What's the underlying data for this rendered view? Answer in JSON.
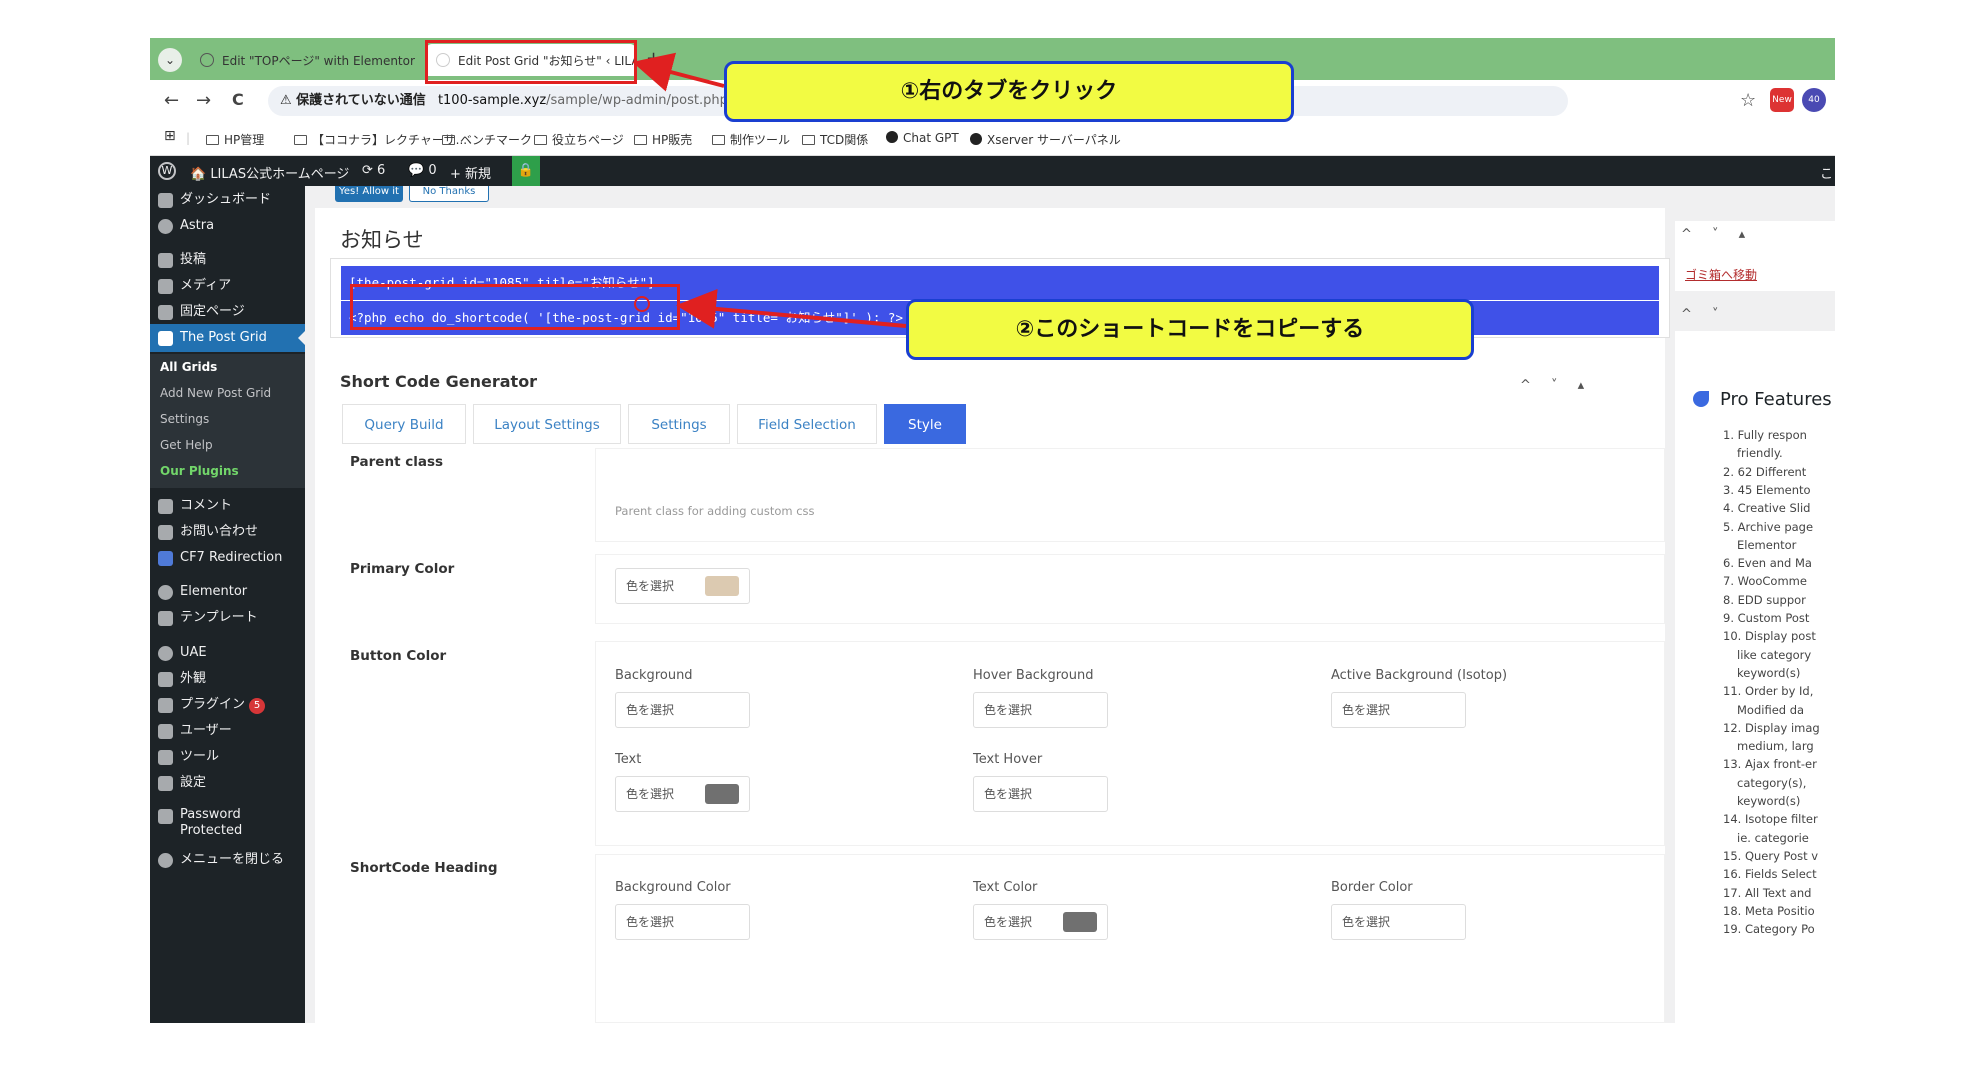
{
  "browser": {
    "tabs": [
      {
        "label": "Edit \"TOPページ\" with Elementor",
        "close": "×"
      },
      {
        "label": "Edit Post Grid \"お知らせ\" ‹ LILAS",
        "close": "×"
      }
    ],
    "new_tab": "+",
    "tab_menu": "⌄",
    "back": "←",
    "forward": "→",
    "reload": "C",
    "security": "⚠ 保護されていない通信",
    "url_host": "t100-sample.xyz",
    "url_path": "/sample/wp-admin/post.php?post=",
    "star": "☆",
    "ext1": "New",
    "ext2": "40",
    "bookmarks_apps": "⊞",
    "bookmarks": [
      "HP管理",
      "【ココナラ】レクチャーサ...",
      "ベンチマーク",
      "役立ちページ",
      "HP販売",
      "制作ツール",
      "TCD関係",
      "Chat GPT",
      "Xserver サーバーパネル"
    ]
  },
  "adminbar": {
    "wp": "W",
    "site": "🏠 LILAS公式ホームページ",
    "updates": "⟳ 6",
    "comments": "💬 0",
    "new": "+ 新規",
    "lock": "🔒",
    "right": "こ"
  },
  "sidebar": {
    "items": [
      {
        "label": "ダッシュボード"
      },
      {
        "label": "Astra"
      },
      {
        "label": "投稿"
      },
      {
        "label": "メディア"
      },
      {
        "label": "固定ページ"
      },
      {
        "label": "The Post Grid"
      },
      {
        "label": "コメント"
      },
      {
        "label": "お問い合わせ"
      },
      {
        "label": "CF7 Redirection"
      },
      {
        "label": "Elementor"
      },
      {
        "label": "テンプレート"
      },
      {
        "label": "UAE"
      },
      {
        "label": "外観"
      },
      {
        "label": "プラグイン"
      },
      {
        "label": "ユーザー"
      },
      {
        "label": "ツール"
      },
      {
        "label": "設定"
      },
      {
        "label": "Password Protected"
      },
      {
        "label": "メニューを閉じる"
      }
    ],
    "plugin_badge": "5",
    "submenu": [
      "All Grids",
      "Add New Post Grid",
      "Settings",
      "Get Help",
      "Our Plugins"
    ]
  },
  "top_buttons": {
    "yes": "Yes! Allow it",
    "no": "No Thanks"
  },
  "post_title": "お知らせ",
  "shortcode": "[the-post-grid id=\"1085\" title=\"お知らせ\"]",
  "php_code": "<?php echo do_shortcode( '[the-post-grid id=\"1085\" title=\"お知らせ\"]' ); ?>",
  "generator": {
    "title": "Short Code Generator",
    "arrows": "^ ˅ ▴",
    "tabs": [
      "Query Build",
      "Layout Settings",
      "Settings",
      "Field Selection",
      "Style"
    ],
    "parent_class": {
      "label": "Parent class",
      "hint": "Parent class for adding custom css"
    },
    "primary_color": {
      "label": "Primary Color",
      "picker": "色を選択",
      "swatch": "#dccab1"
    },
    "button_color": {
      "label": "Button Color",
      "fields": [
        {
          "label": "Background",
          "picker": "色を選択"
        },
        {
          "label": "Hover Background",
          "picker": "色を選択"
        },
        {
          "label": "Active Background (Isotop)",
          "picker": "色を選択"
        },
        {
          "label": "Text",
          "picker": "色を選択",
          "swatch": "#707070"
        },
        {
          "label": "Text Hover",
          "picker": "色を選択"
        }
      ]
    },
    "heading": {
      "label": "ShortCode Heading",
      "fields": [
        {
          "label": "Background Color",
          "picker": "色を選択"
        },
        {
          "label": "Text Color",
          "picker": "色を選択",
          "swatch": "#707070"
        },
        {
          "label": "Border Color",
          "picker": "色を選択"
        }
      ]
    }
  },
  "right_panel": {
    "arrows": "^ ˅ ▴",
    "arrows2": "^ ˅",
    "trash": "ゴミ箱へ移動",
    "pro_title": "Pro Features",
    "pro_items": [
      "1. Fully respon",
      "friendly.",
      "2. 62 Different",
      "3. 45 Elemento",
      "4. Creative Slid",
      "5. Archive page",
      "Elementor",
      "6. Even and Ma",
      "7. WooComme",
      "8. EDD suppor",
      "9. Custom Post",
      "10. Display post",
      "like category",
      "keyword(s)",
      "11. Order by Id,",
      "Modified da",
      "12. Display imag",
      "medium, larg",
      "13. Ajax front-er",
      "category(s),",
      "keyword(s)",
      "14. Isotope filter",
      "ie. categorie",
      "15. Query Post v",
      "16. Fields Select",
      "17. All Text and",
      "18. Meta Positio",
      "19. Category Po"
    ]
  },
  "annotations": {
    "step1": "①右のタブをクリック",
    "step2": "②このショートコードをコピーする"
  },
  "colors": {
    "accent": "#2271b1",
    "annotation_red": "#e02020",
    "callout_bg": "#f2fb43",
    "callout_border": "#1a3fd0"
  }
}
